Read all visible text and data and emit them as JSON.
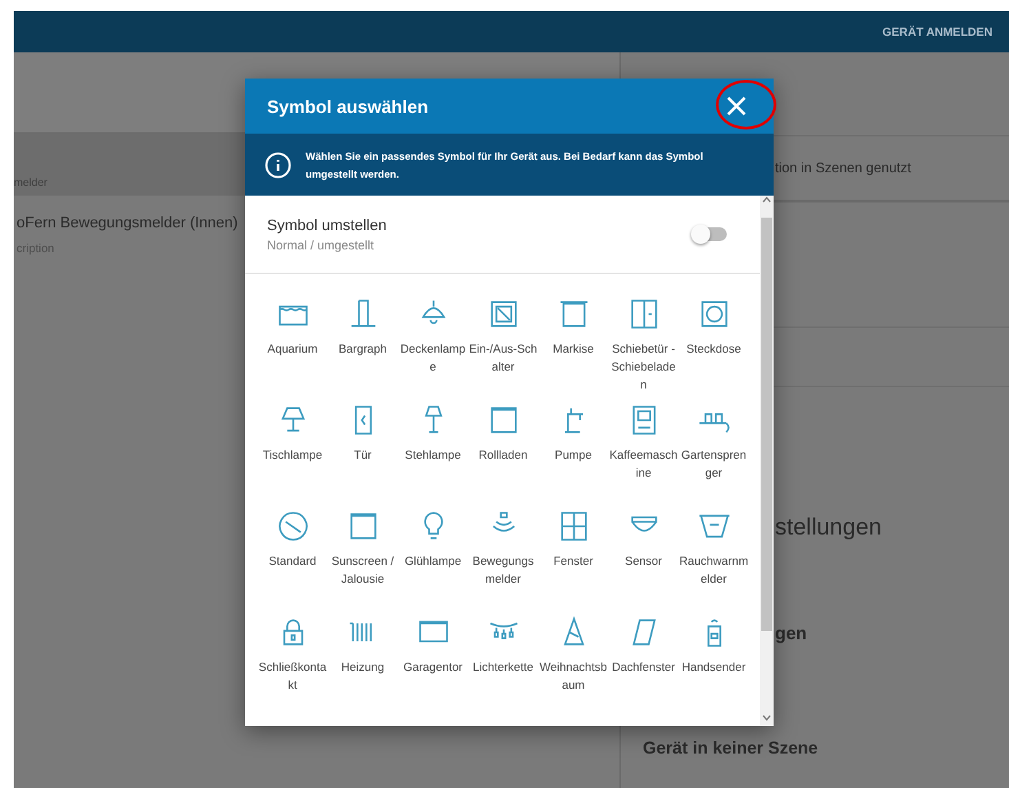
{
  "app_bar": {
    "action": "GERÄT ANMELDEN"
  },
  "device_list": {
    "column_label": "melder",
    "device": {
      "name": "oFern Bewegungsmelder (Innen)",
      "description": "cription"
    }
  },
  "detail_panel": {
    "scene_usage": "tion in Szenen genutzt",
    "section_1": "stellungen",
    "section_2": "gen",
    "scene_status": "Gerät in keiner Szene"
  },
  "dialog": {
    "title": "Symbol auswählen",
    "info": "Wählen Sie ein passendes Symbol für Ihr Gerät aus. Bei Bedarf kann das Symbol umgestellt werden.",
    "toggle": {
      "label": "Symbol umstellen",
      "sublabel": "Normal / umgestellt",
      "on": false
    },
    "symbols": [
      {
        "label": "Aquarium",
        "selected": false
      },
      {
        "label": "Bargraph",
        "selected": false
      },
      {
        "label": "Deckenlampe",
        "selected": false
      },
      {
        "label": "Ein-/Aus-Schalter",
        "selected": false
      },
      {
        "label": "Markise",
        "selected": false
      },
      {
        "label": "Schiebetür - Schiebeladen",
        "selected": false
      },
      {
        "label": "Steckdose",
        "selected": false
      },
      {
        "label": "Tischlampe",
        "selected": false
      },
      {
        "label": "Tür",
        "selected": false
      },
      {
        "label": "Stehlampe",
        "selected": false
      },
      {
        "label": "Rollladen",
        "selected": false
      },
      {
        "label": "Pumpe",
        "selected": false
      },
      {
        "label": "Kaffeemaschine",
        "selected": false
      },
      {
        "label": "Gartensprenger",
        "selected": false
      },
      {
        "label": "Standard",
        "selected": false
      },
      {
        "label": "Sunscreen / Jalousie",
        "selected": false
      },
      {
        "label": "Glühlampe",
        "selected": false
      },
      {
        "label": "Bewegungsmelder",
        "selected": false
      },
      {
        "label": "Fenster",
        "selected": false
      },
      {
        "label": "Sensor",
        "selected": false
      },
      {
        "label": "Rauchwarnmelder",
        "selected": false
      },
      {
        "label": "Schließkontakt",
        "selected": false
      },
      {
        "label": "Heizung",
        "selected": false
      },
      {
        "label": "Garagentor",
        "selected": false
      },
      {
        "label": "Lichterkette",
        "selected": false
      },
      {
        "label": "Weihnachtsbaum",
        "selected": false
      },
      {
        "label": "Dachfenster",
        "selected": false
      },
      {
        "label": "Handsender",
        "selected": false
      }
    ]
  }
}
